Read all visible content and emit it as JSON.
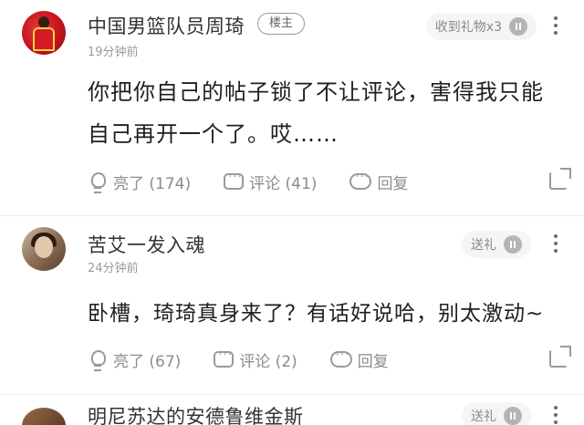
{
  "comments": [
    {
      "username": "中国男篮队员周琦",
      "badge": "楼主",
      "timestamp": "19分钟前",
      "gift_label": "收到礼物x3",
      "text": "你把你自己的帖子锁了不让评论，害得我只能自己再开一个了。哎……",
      "actions": {
        "like": "亮了 (174)",
        "comment": "评论 (41)",
        "reply": "回复"
      }
    },
    {
      "username": "苦艾一发入魂",
      "timestamp": "24分钟前",
      "gift_label": "送礼",
      "text": "卧槽，琦琦真身来了？有话好说哈，别太激动~",
      "actions": {
        "like": "亮了 (67)",
        "comment": "评论 (2)",
        "reply": "回复"
      }
    },
    {
      "username": "明尼苏达的安德鲁维金斯",
      "gift_label": "送礼"
    }
  ]
}
